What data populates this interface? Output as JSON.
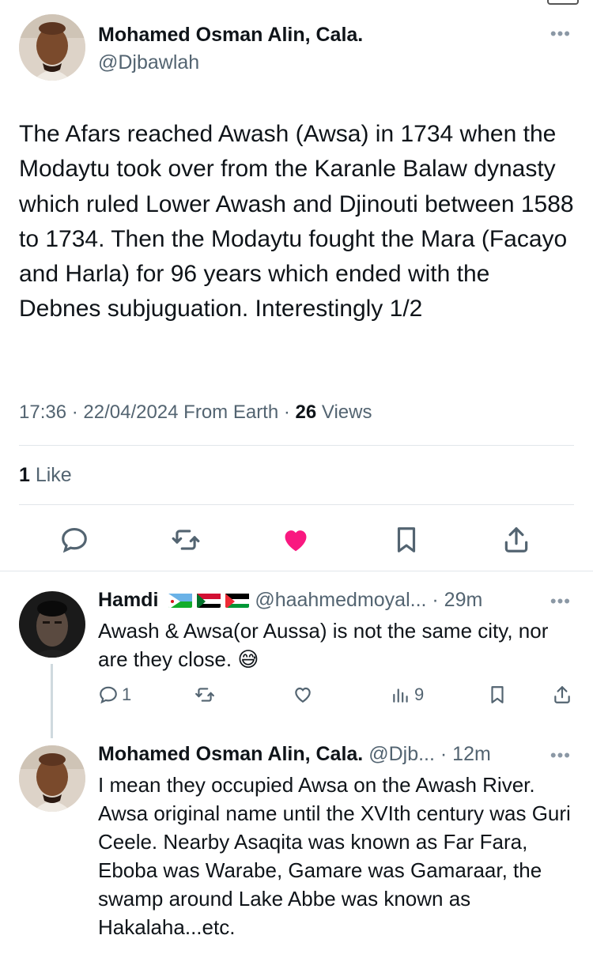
{
  "main_tweet": {
    "author_name": "Mohamed Osman Alin, Cala.",
    "author_handle": "@Djbawlah",
    "text": "The Afars reached Awash (Awsa) in 1734 when the Modaytu took over from the Karanle Balaw dynasty which ruled Lower Awash and Djinouti between 1588 to 1734. Then the Modaytu fought the Mara (Facayo and Harla) for 96 years which ended with the Debnes subjuguation. Interestingly 1/2",
    "meta_prefix": "17:36 · 22/04/2024 From Earth · ",
    "views_count": "26",
    "views_label": " Views",
    "likes_count": "1",
    "likes_label": " Like",
    "liked": true,
    "colors": {
      "heart": "#f91880",
      "icon": "#536471"
    }
  },
  "replies": [
    {
      "author_name": "Hamdi",
      "flags": [
        "djibouti",
        "sudan",
        "palestine"
      ],
      "meta": "@haahmedmoyal... · 29m",
      "text": "Awash & Awsa(or Aussa) is not the same city, nor are they close.",
      "emoji": "😅",
      "reply_count": "1",
      "views_count": "9"
    },
    {
      "author_name": "Mohamed Osman Alin, Cala.",
      "meta": "@Djb... · 12m",
      "text": "I mean they occupied Awsa on the Awash River. Awsa original name until the XVIth century was Guri Ceele. Nearby Asaqita was known as Far Fara, Eboba was Warabe, Gamare was Gamaraar, the swamp around Lake Abbe was known as Hakalaha...etc."
    }
  ]
}
